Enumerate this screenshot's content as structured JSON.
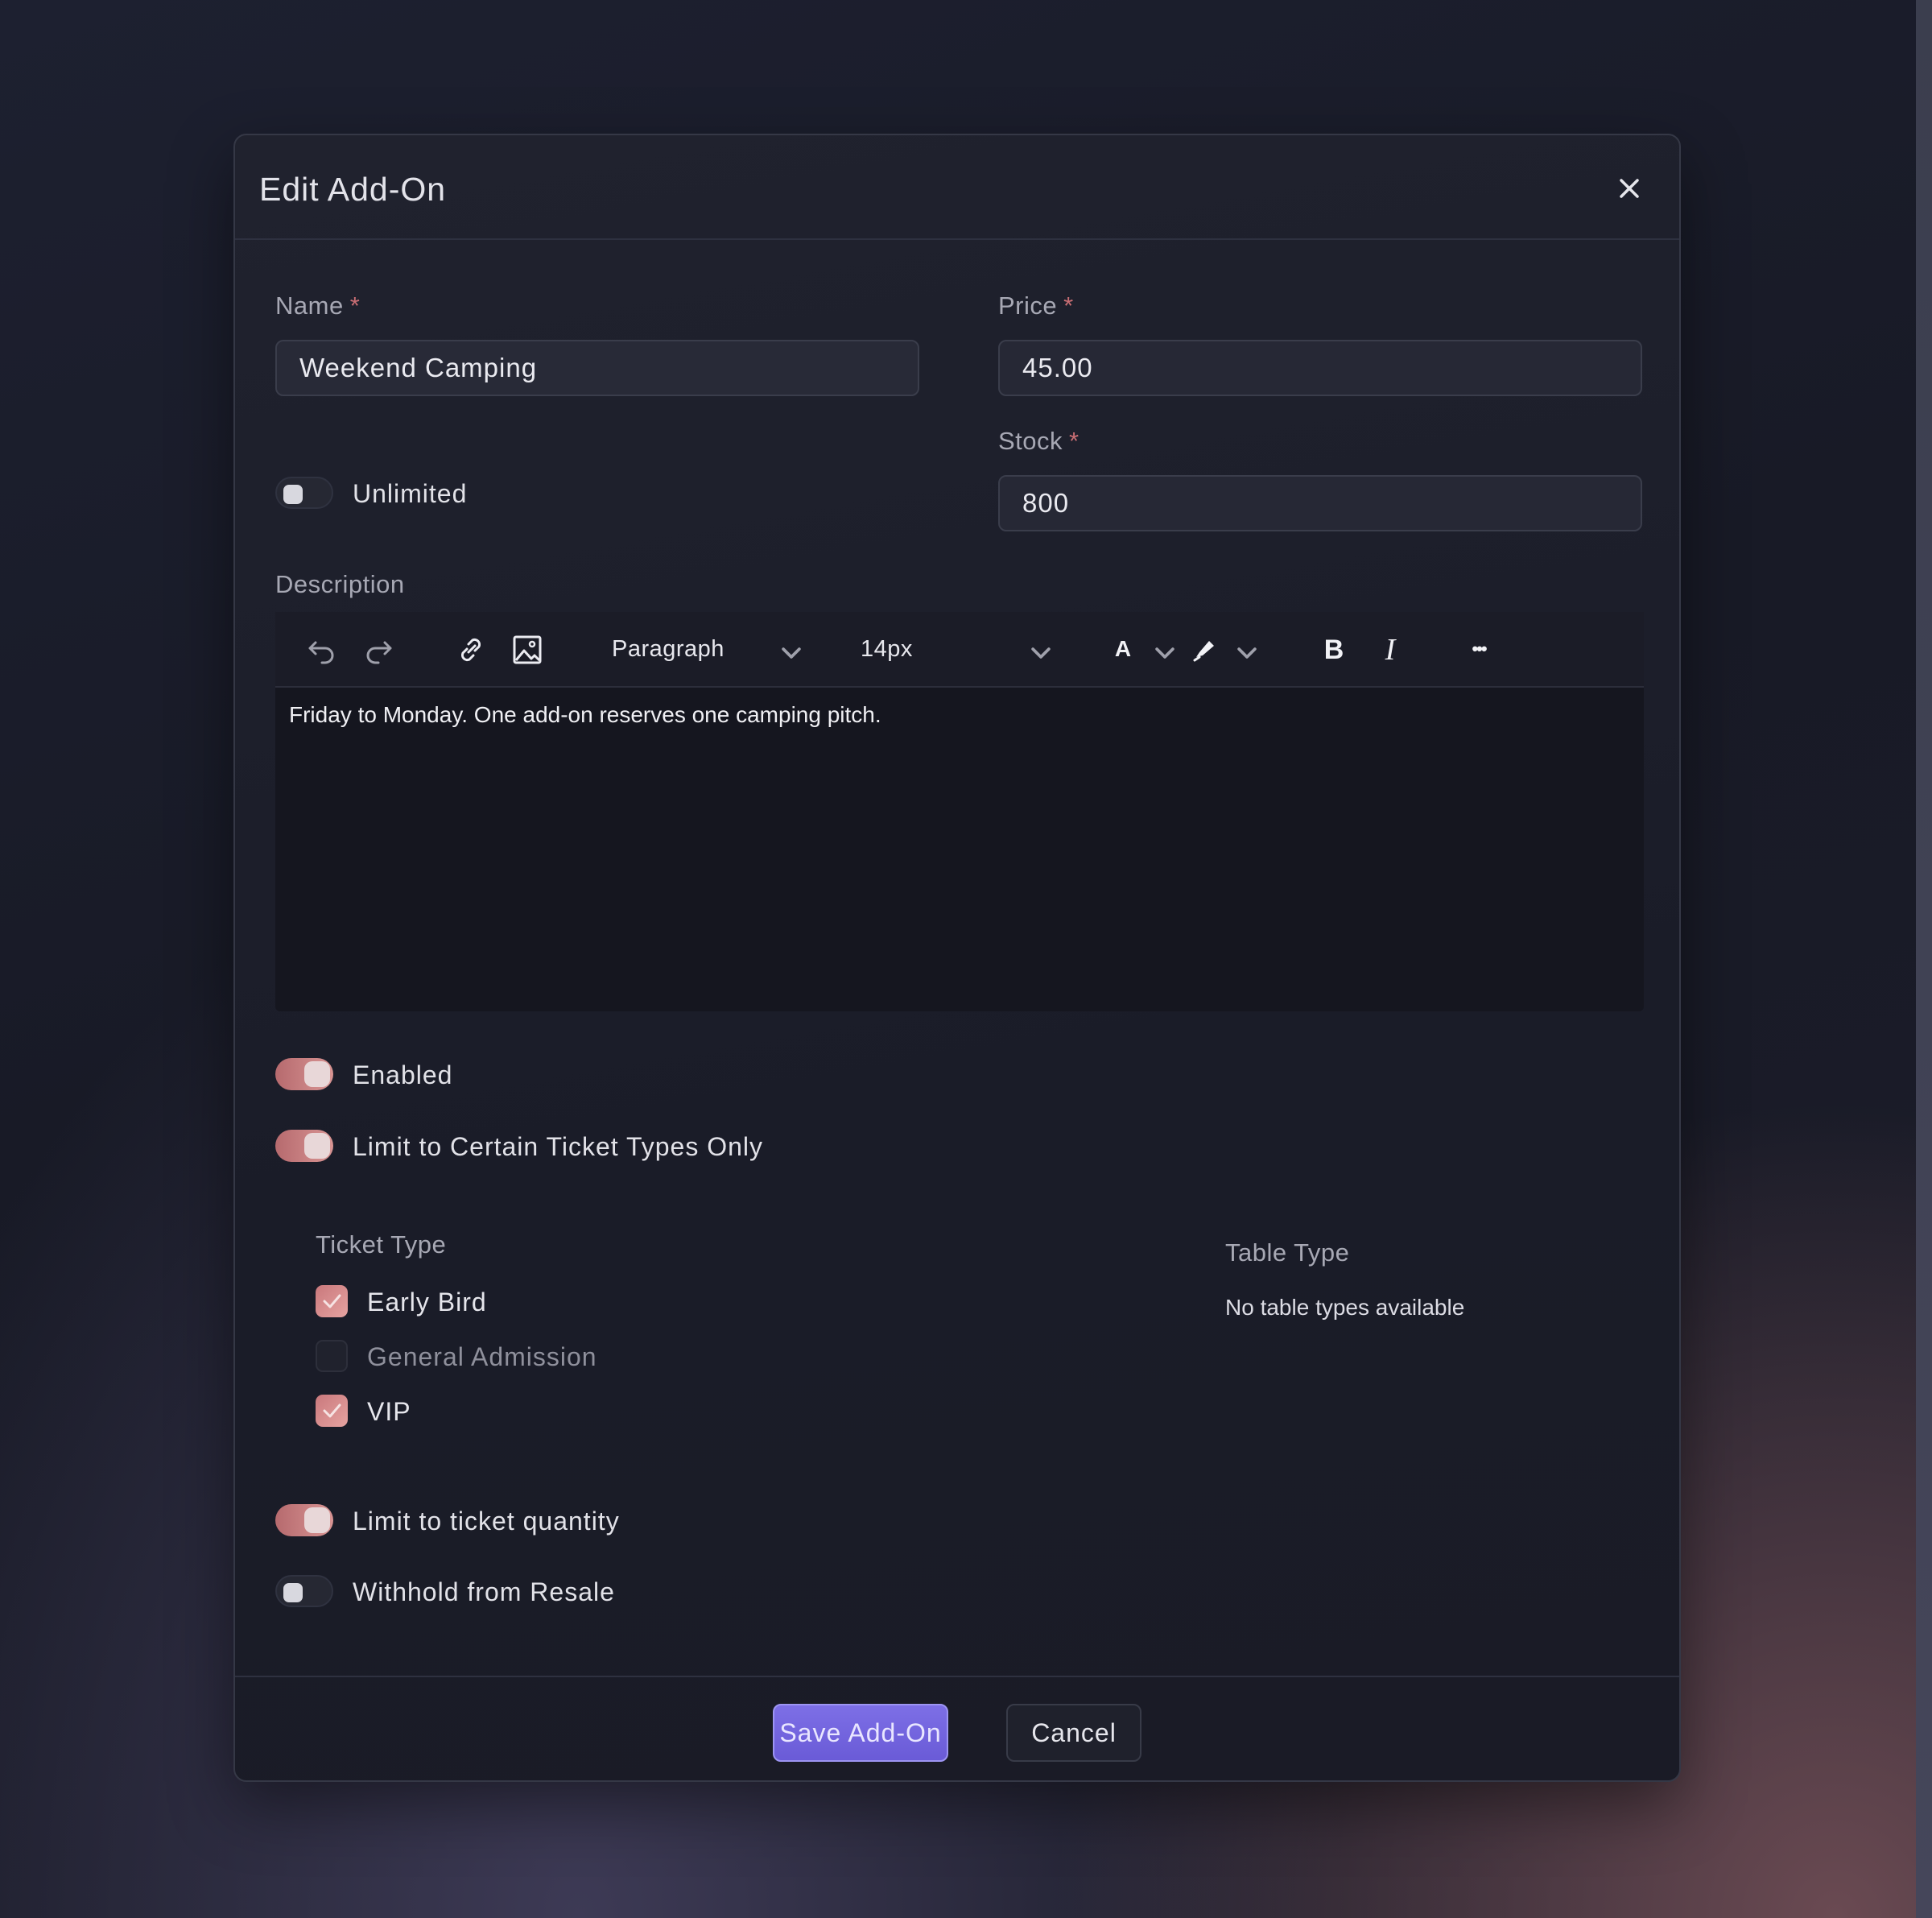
{
  "dialog": {
    "title": "Edit Add-On"
  },
  "fields": {
    "name": {
      "label": "Name",
      "required_mark": "*",
      "value": "Weekend Camping"
    },
    "price": {
      "label": "Price",
      "required_mark": "*",
      "value": "45.00"
    },
    "stock": {
      "label": "Stock",
      "required_mark": "*",
      "value": "800"
    },
    "unlimited": {
      "label": "Unlimited",
      "on": false
    }
  },
  "description": {
    "label": "Description",
    "toolbar": {
      "block_format": "Paragraph",
      "font_size": "14px",
      "font_color_glyph": "A",
      "bold_glyph": "B",
      "italic_glyph": "I",
      "more_glyph": "•••"
    },
    "content": "Friday to Monday. One add-on reserves one camping pitch."
  },
  "toggles": {
    "enabled": {
      "label": "Enabled",
      "on": true
    },
    "limit_ticket_types": {
      "label": "Limit to Certain Ticket Types Only",
      "on": true
    },
    "limit_quantity": {
      "label": "Limit to ticket quantity",
      "on": true
    },
    "withhold_resale": {
      "label": "Withhold from Resale",
      "on": false
    }
  },
  "ticket_types": {
    "heading": "Ticket Type",
    "items": [
      {
        "label": "Early Bird",
        "checked": true
      },
      {
        "label": "General Admission",
        "checked": false
      },
      {
        "label": "VIP",
        "checked": true
      }
    ]
  },
  "table_types": {
    "heading": "Table Type",
    "empty_text": "No table types available"
  },
  "footer": {
    "save_label": "Save Add-On",
    "cancel_label": "Cancel"
  },
  "colors": {
    "accent": "#7566e0",
    "toggle_on": "#c98083",
    "required": "#c96e74"
  }
}
